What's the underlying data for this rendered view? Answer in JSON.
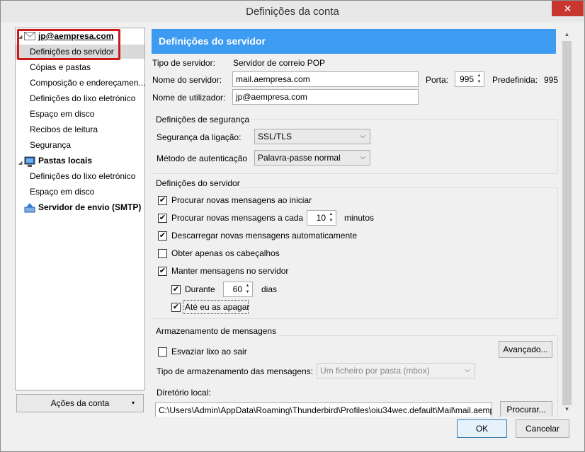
{
  "window": {
    "title": "Definições da conta",
    "close_glyph": "✕"
  },
  "tree": {
    "account": "jp@aempresa.com",
    "account_items": [
      "Definições do servidor",
      "Cópias e pastas",
      "Composição e endereçamen...",
      "Definições do lixo eletrónico",
      "Espaço em disco",
      "Recibos de leitura",
      "Segurança"
    ],
    "local_folders": "Pastas locais",
    "local_items": [
      "Definições do lixo eletrónico",
      "Espaço em disco"
    ],
    "smtp": "Servidor de envio (SMTP)",
    "icons": {
      "account": "envelope-icon",
      "local": "computer-icon",
      "smtp": "upload-server-icon",
      "collapse": "triangle-down-icon"
    }
  },
  "account_actions": {
    "label": "Ações da conta",
    "arrow": "▾"
  },
  "panel": {
    "header": "Definições do servidor",
    "server_type_label": "Tipo de servidor:",
    "server_type_value": "Servidor de correio POP",
    "server_name_label": "Nome do servidor:",
    "server_name_value": "mail.aempresa.com",
    "port_label": "Porta:",
    "port_value": "995",
    "default_label": "Predefinida:",
    "default_value": "995",
    "username_label": "Nome de utilizador:",
    "username_value": "jp@aempresa.com",
    "security": {
      "title": "Definições de segurança",
      "connection_label": "Segurança da ligação:",
      "connection_value": "SSL/TLS",
      "auth_label": "Método de autenticação",
      "auth_value": "Palavra-passe normal"
    },
    "server_settings": {
      "title": "Definições do servidor",
      "check_new_startup": {
        "label": "Procurar novas mensagens ao iniciar",
        "checked": true
      },
      "check_every": {
        "label": "Procurar novas mensagens a cada",
        "checked": true,
        "value": "10",
        "unit": "minutos"
      },
      "auto_download": {
        "label": "Descarregar novas mensagens automaticamente",
        "checked": true
      },
      "headers_only": {
        "label": "Obter apenas os cabeçalhos",
        "checked": false
      },
      "leave_on_server": {
        "label": "Manter mensagens no servidor",
        "checked": true
      },
      "for_days": {
        "label": "Durante",
        "checked": true,
        "value": "60",
        "unit": "dias"
      },
      "until_deleted": {
        "label": "Até eu as apagar",
        "checked": true
      }
    },
    "storage": {
      "title": "Armazenamento de mensagens",
      "empty_trash": {
        "label": "Esvaziar lixo ao sair",
        "checked": false
      },
      "advanced_button": "Avançado...",
      "store_type_label": "Tipo de armazenamento das mensagens:",
      "store_type_value": "Um ficheiro por pasta (mbox)",
      "local_dir_label": "Diretório local:",
      "local_dir_value": "C:\\Users\\Admin\\AppData\\Roaming\\Thunderbird\\Profiles\\oiu34wec.default\\Mail\\mail.aempresa.com",
      "browse_button": "Procurar..."
    }
  },
  "footer": {
    "ok": "OK",
    "cancel": "Cancelar"
  },
  "check_glyph": "✔"
}
